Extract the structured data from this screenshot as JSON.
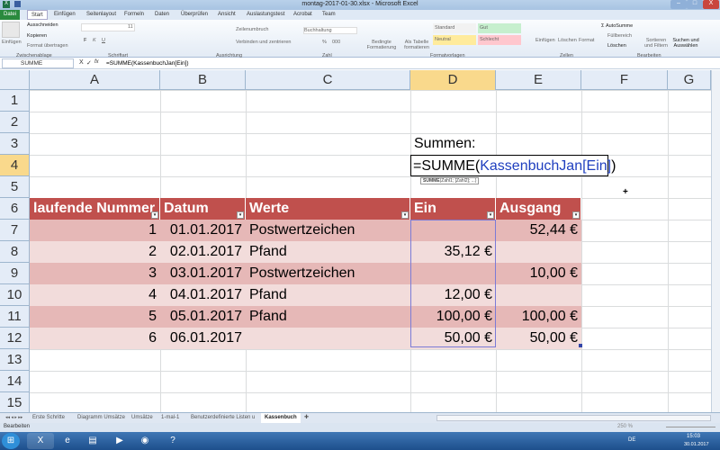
{
  "window": {
    "title": "montag-2017-01-30.xlsx - Microsoft Excel",
    "min": "–",
    "max": "□",
    "close": "X"
  },
  "ribbon_tabs": [
    "Datei",
    "Start",
    "Einfügen",
    "Seitenlayout",
    "Formeln",
    "Daten",
    "Überprüfen",
    "Ansicht",
    "Auslastungstest",
    "Acrobat",
    "Team"
  ],
  "ribbon": {
    "clipboard": {
      "paste": "Einfügen",
      "cut": "Ausschneiden",
      "copy": "Kopieren",
      "format": "Format übertragen",
      "group": "Zwischenablage"
    },
    "font": {
      "size": "11",
      "group": "Schriftart",
      "bold": "F",
      "italic": "K",
      "underline": "U"
    },
    "alignment": {
      "wrap": "Zeilenumbruch",
      "merge": "Verbinden und zentrieren",
      "group": "Ausrichtung"
    },
    "number": {
      "format": "Buchhaltung",
      "group": "Zahl",
      "percent": "%",
      "thousands": "000"
    },
    "styles": {
      "cond": "Bedingte Formatierung",
      "table": "Als Tabelle formatieren",
      "standard": "Standard",
      "gut": "Gut",
      "neutral": "Neutral",
      "schlecht": "Schlecht",
      "group": "Formatvorlagen"
    },
    "cells": {
      "insert": "Einfügen",
      "delete": "Löschen",
      "format": "Format",
      "group": "Zellen"
    },
    "editing": {
      "autosum": "AutoSumme",
      "fill": "Füllbereich",
      "clear": "Löschen",
      "sort": "Sortieren und Filtern",
      "find": "Suchen und Auswählen",
      "group": "Bearbeiten"
    }
  },
  "formula_bar": {
    "name_box": "SUMME",
    "cancel": "X",
    "enter": "✓",
    "fx": "fx",
    "formula": "=SUMME(KassenbuchJan[Ein])"
  },
  "columns": [
    "A",
    "B",
    "C",
    "D",
    "E",
    "F",
    "G"
  ],
  "rows": [
    "1",
    "2",
    "3",
    "4",
    "5",
    "6",
    "7",
    "8",
    "9",
    "10",
    "11",
    "12",
    "13",
    "14",
    "15"
  ],
  "cells": {
    "d3": "Summen:",
    "d4_prefix": "=SUMME(",
    "d4_ref": "KassenbuchJan[Ein]",
    "d4_suffix": ")",
    "tooltip_bold": "SUMME",
    "tooltip_rest": "(Zahl1; [Zahl2]; ...)"
  },
  "table": {
    "headers": [
      "laufende Nummer",
      "Datum",
      "Werte",
      "Ein",
      "Ausgang"
    ],
    "rows": [
      [
        "1",
        "01.01.2017",
        "Postwertzeichen",
        "",
        "52,44 €"
      ],
      [
        "2",
        "02.01.2017",
        "Pfand",
        "35,12 €",
        ""
      ],
      [
        "3",
        "03.01.2017",
        "Postwertzeichen",
        "",
        "10,00 €"
      ],
      [
        "4",
        "04.01.2017",
        "Pfand",
        "12,00 €",
        ""
      ],
      [
        "5",
        "05.01.2017",
        "Pfand",
        "100,00 €",
        "100,00 €"
      ],
      [
        "6",
        "06.01.2017",
        "",
        "50,00 €",
        "50,00 €"
      ]
    ]
  },
  "sheet_tabs": [
    "Erste Schritte",
    "Diagramm Umsätze",
    "Umsätze",
    "1-mal-1",
    "Benutzerdefinierte Listen u",
    "Kassenbuch"
  ],
  "status": {
    "mode": "Bearbeiten",
    "zoom": "250 %"
  },
  "taskbar": {
    "lang": "DE",
    "time": "15:03",
    "date": "30.01.2017"
  },
  "colors": {
    "header": "#c0504d",
    "band_dark": "#e6b8b7",
    "band_light": "#f2dcdb",
    "ref_blue": "#1f3fbf"
  }
}
